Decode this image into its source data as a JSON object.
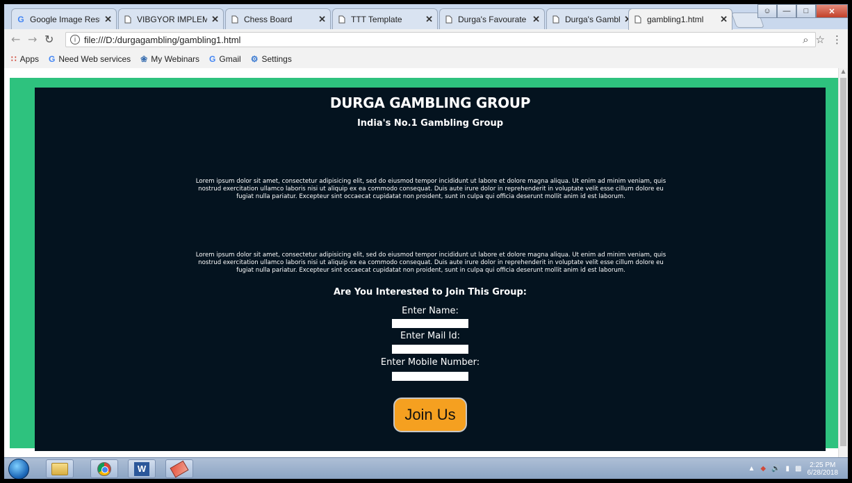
{
  "tabs": [
    {
      "label": "Google Image Resul",
      "icon": "google-icon"
    },
    {
      "label": "VIBGYOR IMPLEMEN",
      "icon": "document-icon"
    },
    {
      "label": "Chess Board",
      "icon": "document-icon"
    },
    {
      "label": "TTT Template",
      "icon": "document-icon"
    },
    {
      "label": "Durga's Favourate P",
      "icon": "document-icon"
    },
    {
      "label": "Durga's Gamblers G",
      "icon": "document-icon"
    },
    {
      "label": "gambling1.html",
      "icon": "document-icon"
    }
  ],
  "address": {
    "url": "file:///D:/durgagambling/gambling1.html"
  },
  "bookmarks": [
    {
      "label": "Apps",
      "icon": "apps-icon"
    },
    {
      "label": "Need Web services",
      "icon": "google-icon"
    },
    {
      "label": "My Webinars",
      "icon": "webinar-icon"
    },
    {
      "label": "Gmail",
      "icon": "google-icon"
    },
    {
      "label": "Settings",
      "icon": "gear-icon"
    }
  ],
  "page": {
    "title": "DURGA GAMBLING GROUP",
    "subtitle": "India's No.1 Gambling Group",
    "paragraph1": "Lorem ipsum dolor sit amet, consectetur adipisicing elit, sed do eiusmod tempor incididunt ut labore et dolore magna aliqua. Ut enim ad minim veniam, quis nostrud exercitation ullamco laboris nisi ut aliquip ex ea commodo consequat. Duis aute irure dolor in reprehenderit in voluptate velit esse cillum dolore eu fugiat nulla pariatur. Excepteur sint occaecat cupidatat non proident, sunt in culpa qui officia deserunt mollit anim id est laborum.",
    "paragraph2": "Lorem ipsum dolor sit amet, consectetur adipisicing elit, sed do eiusmod tempor incididunt ut labore et dolore magna aliqua. Ut enim ad minim veniam, quis nostrud exercitation ullamco laboris nisi ut aliquip ex ea commodo consequat. Duis aute irure dolor in reprehenderit in voluptate velit esse cillum dolore eu fugiat nulla pariatur. Excepteur sint occaecat cupidatat non proident, sunt in culpa qui officia deserunt mollit anim id est laborum.",
    "join_heading": "Are You Interested to Join This Group:",
    "name_label": "Enter Name:",
    "mail_label": "Enter Mail Id:",
    "mobile_label": "Enter Mobile Number:",
    "name_value": "",
    "mail_value": "",
    "mobile_value": "",
    "join_button": "Join Us"
  },
  "taskbar": {
    "time": "2:25 PM",
    "date": "6/28/2018"
  },
  "colors": {
    "page_background": "#04131f",
    "page_border": "#2ec27e",
    "join_button": "#f5a020"
  }
}
